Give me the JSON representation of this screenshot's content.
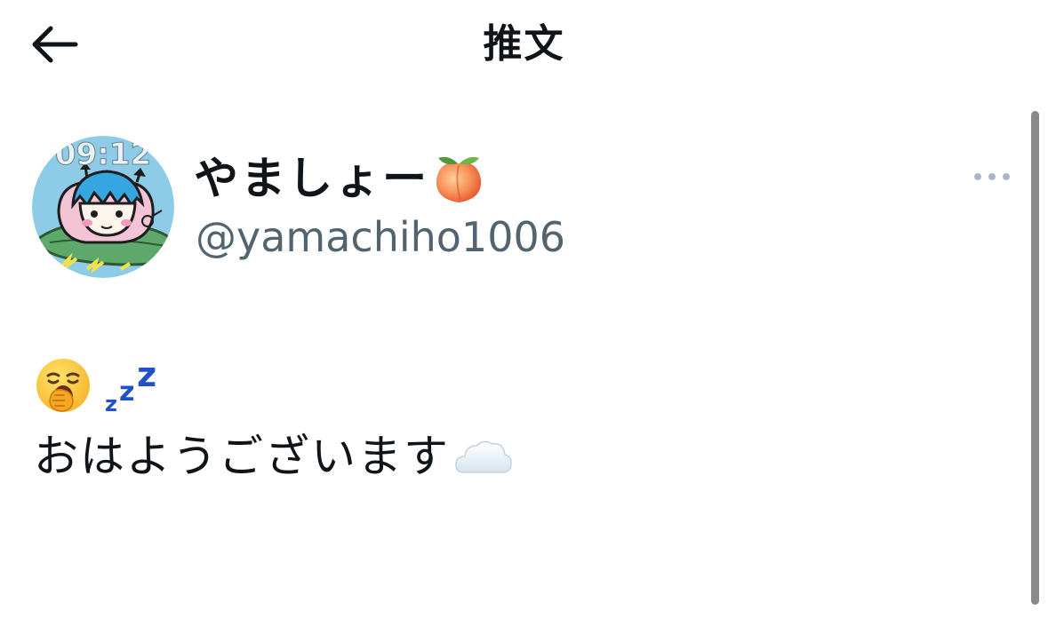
{
  "header": {
    "title": "推文",
    "back_icon": "arrow-left-icon"
  },
  "tweet": {
    "author": {
      "display_name": "やましょー",
      "name_emoji": "peach-icon",
      "handle": "@yamachiho1006",
      "avatar": {
        "clock_text": "09:12",
        "description": "avatar-illustration"
      }
    },
    "more_icon": "more-horizontal-icon",
    "body": {
      "emojis": [
        "yawning-face-icon",
        "zzz-icon"
      ],
      "text": "おはようございます",
      "trailing_emoji": "cloud-icon"
    }
  },
  "colors": {
    "text_primary": "#0f1419",
    "text_secondary": "#536471",
    "more_dots": "#aab8c2",
    "zzz_blue": "#2151c8",
    "scrollbar": "#8a8a8a"
  }
}
